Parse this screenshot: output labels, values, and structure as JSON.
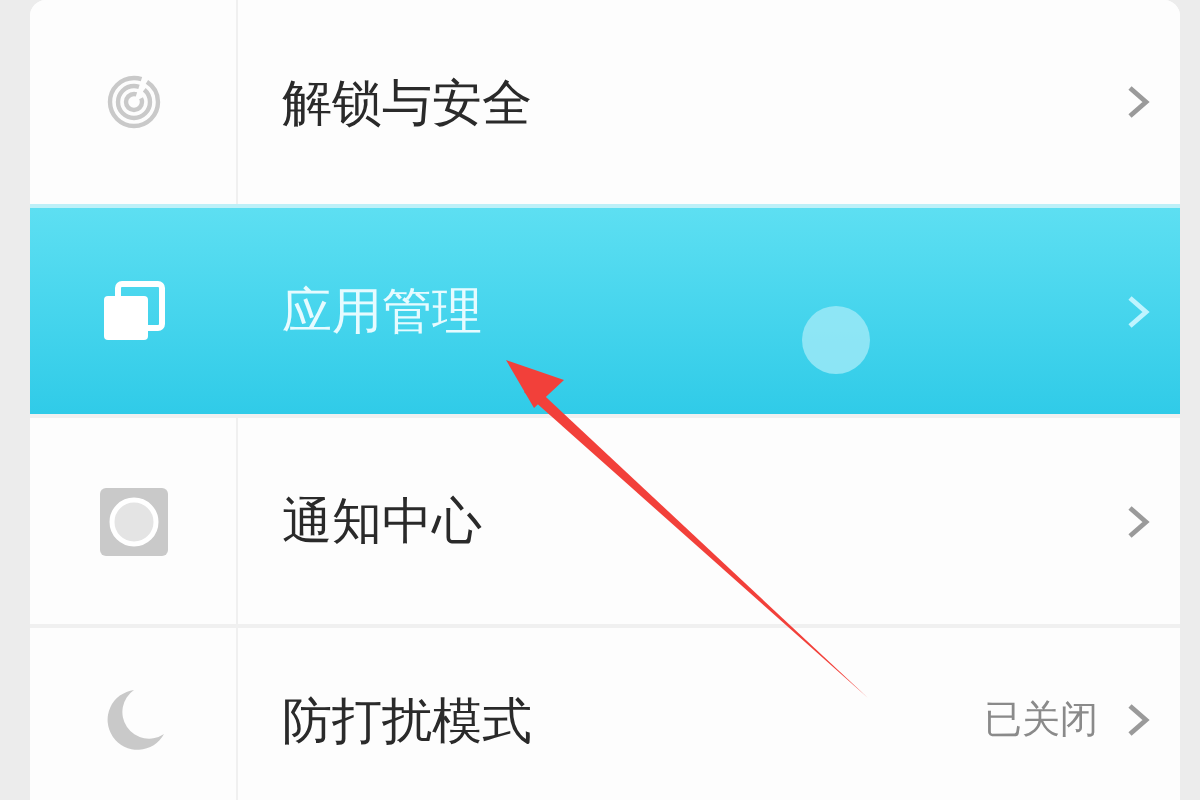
{
  "settings": [
    {
      "label": "解锁与安全",
      "selected": false
    },
    {
      "label": "应用管理",
      "selected": true
    },
    {
      "label": "通知中心",
      "selected": false
    },
    {
      "label": "防打扰模式",
      "selected": false,
      "value": "已关闭"
    }
  ]
}
